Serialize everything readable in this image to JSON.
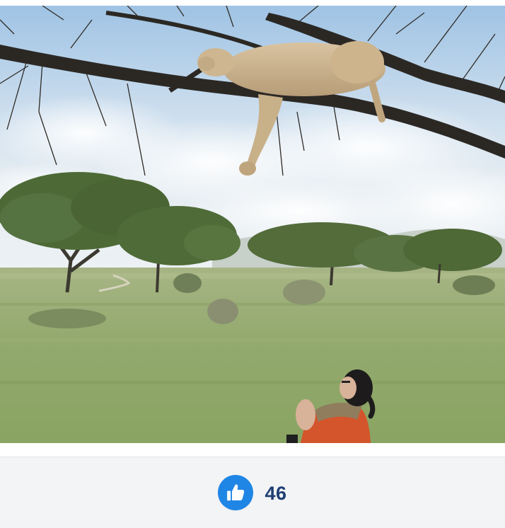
{
  "photo": {
    "description_icon": "photo-lioness-in-tree"
  },
  "reactions": {
    "like_icon": "thumbs-up-icon",
    "like_count": "46",
    "accent_color": "#1f86e6",
    "count_color": "#1f3f73"
  }
}
